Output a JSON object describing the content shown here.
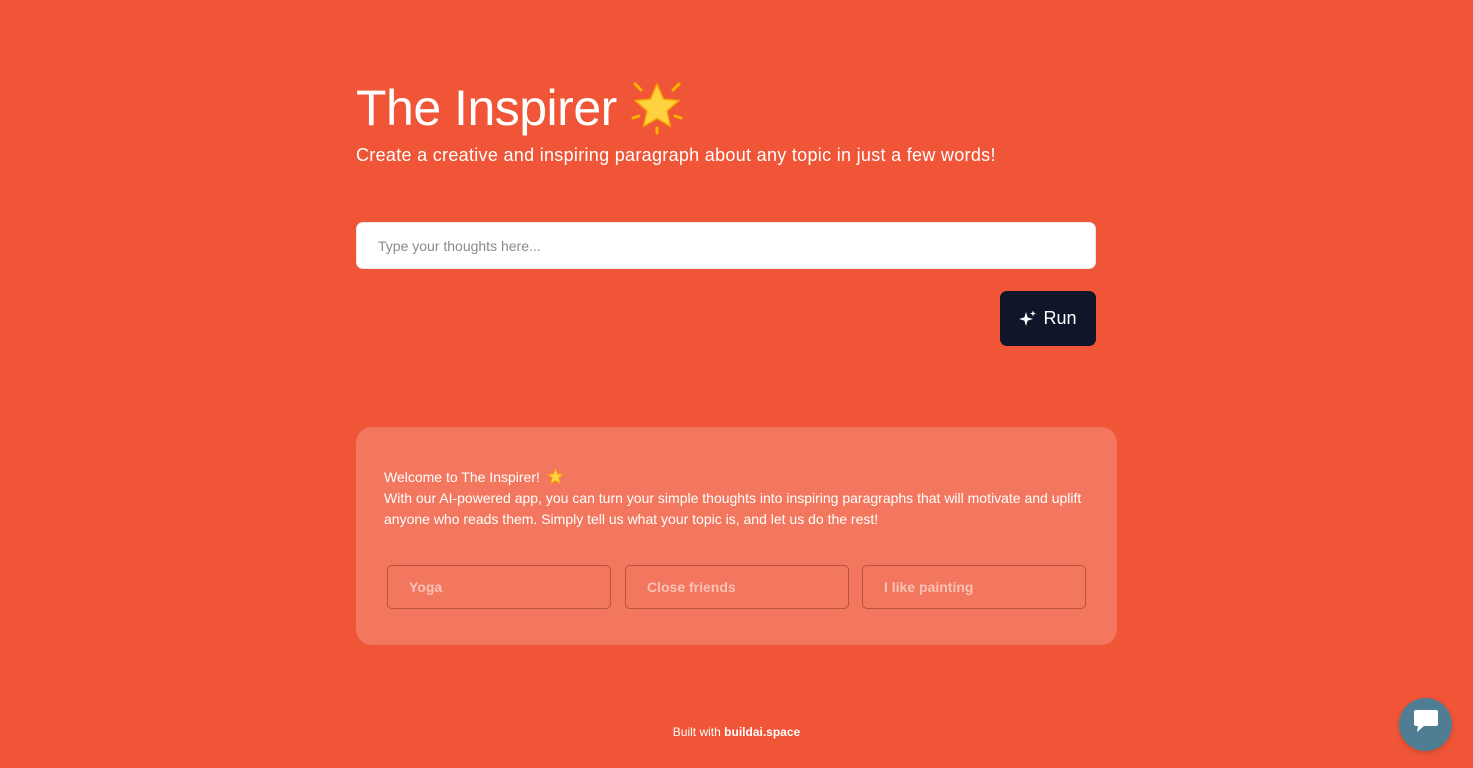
{
  "header": {
    "title": "The Inspirer",
    "title_icon": "glowing-star-icon",
    "subtitle": "Create a creative and inspiring paragraph about any topic in just a few words!"
  },
  "prompt": {
    "placeholder": "Type your thoughts here...",
    "value": ""
  },
  "run_button": {
    "label": "Run",
    "icon": "sparkle-icon"
  },
  "welcome_card": {
    "heading": "Welcome to The Inspirer!",
    "body": "With our AI-powered app, you can turn your simple thoughts into inspiring paragraphs that will motivate and uplift anyone who reads them. Simply tell us what your topic is, and let us do the rest!",
    "examples": [
      "Yoga",
      "Close friends",
      "I like painting"
    ]
  },
  "footer": {
    "prefix": "Built with",
    "brand": "buildai.space"
  },
  "chat_widget": {
    "icon": "chat-icon"
  },
  "colors": {
    "background": "#F05537",
    "card": "#F2775E",
    "run_button": "#0F1629",
    "chat_bubble": "#4F7D93"
  }
}
